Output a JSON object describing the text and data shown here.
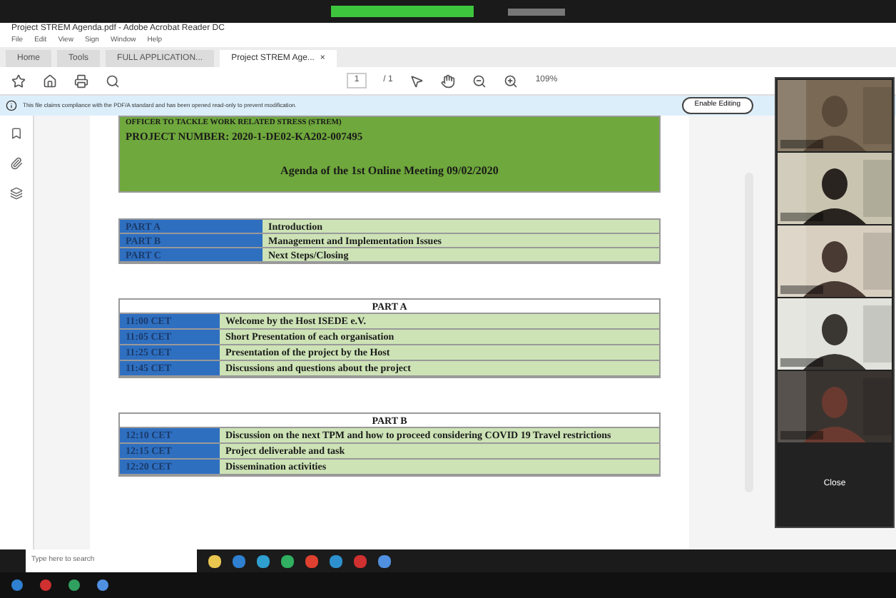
{
  "window": {
    "title": "Project STREM Agenda.pdf - Adobe Acrobat Reader DC"
  },
  "menu": [
    "File",
    "Edit",
    "View",
    "Sign",
    "Window",
    "Help"
  ],
  "tabs": [
    {
      "label": "Home",
      "selected": false
    },
    {
      "label": "Tools",
      "selected": false
    },
    {
      "label": "FULL APPLICATION...",
      "selected": false
    },
    {
      "label": "Project STREM Age...",
      "selected": true,
      "closable": "×"
    }
  ],
  "toolbar": {
    "page": "1",
    "pages": "/ 1",
    "zoom": "109%"
  },
  "info_bar": {
    "message": "This file claims compliance with the PDF/A standard and has been opened read-only to prevent modification.",
    "button": "Enable Editing"
  },
  "document": {
    "header": [
      "OFFICER TO TACKLE WORK RELATED STRESS (STREM)",
      "PROJECT NUMBER: 2020-1-DE02-KA202-007495",
      "Agenda of the 1st Online Meeting 09/02/2020"
    ],
    "overview": [
      [
        "PART A",
        "Introduction"
      ],
      [
        "PART B",
        "Management and Implementation Issues"
      ],
      [
        "PART C",
        "Next Steps/Closing"
      ]
    ],
    "sections": [
      {
        "title": "PART A",
        "rows": [
          [
            "11:00 CET",
            "Welcome by the Host ISEDE e.V."
          ],
          [
            "11:05 CET",
            "Short Presentation of each organisation"
          ],
          [
            "11:25 CET",
            "Presentation of the project by the Host"
          ],
          [
            "11:45 CET",
            "Discussions and questions about the project"
          ]
        ]
      },
      {
        "title": "PART B",
        "rows": [
          [
            "12:10 CET",
            "Discussion on the next TPM and how to proceed considering COVID 19 Travel restrictions"
          ],
          [
            "12:15 CET",
            "Project deliverable and task"
          ],
          [
            "12:20 CET",
            "Dissemination activities"
          ]
        ]
      }
    ]
  },
  "video_panel": {
    "button": "Close"
  },
  "remote_taskbar": {
    "search_placeholder": "Type here to search"
  }
}
